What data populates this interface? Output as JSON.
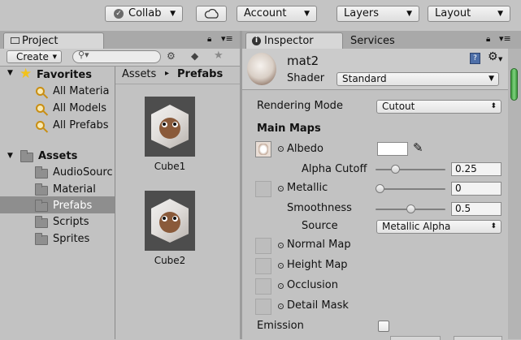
{
  "toolbar": {
    "collab": {
      "label": "Collab",
      "icon": "check-circle-icon"
    },
    "cloud": {
      "icon": "cloud-icon"
    },
    "account": {
      "label": "Account"
    },
    "layers": {
      "label": "Layers"
    },
    "layout": {
      "label": "Layout"
    }
  },
  "project": {
    "tab_label": "Project",
    "create_label": "Create",
    "search_placeholder": "",
    "favorites": {
      "label": "Favorites",
      "items": [
        "All Materia",
        "All Models",
        "All Prefabs"
      ]
    },
    "assets": {
      "label": "Assets",
      "folders": [
        "AudioSourc",
        "Material",
        "Prefabs",
        "Scripts",
        "Sprites"
      ],
      "selected": "Prefabs"
    },
    "breadcrumb": {
      "root": "Assets",
      "separator": "▸",
      "current": "Prefabs"
    },
    "items": [
      "Cube1",
      "Cube2"
    ]
  },
  "inspector": {
    "tab_label": "Inspector",
    "services_tab_label": "Services",
    "material_name": "mat2",
    "shader_label": "Shader",
    "shader_value": "Standard",
    "rendering_mode_label": "Rendering Mode",
    "rendering_mode_value": "Cutout",
    "main_maps_label": "Main Maps",
    "albedo_label": "Albedo",
    "albedo_color": "#ffffff",
    "alpha_cutoff_label": "Alpha Cutoff",
    "alpha_cutoff_value": "0.25",
    "alpha_cutoff_fraction": 0.25,
    "metallic_label": "Metallic",
    "metallic_value": "0",
    "metallic_fraction": 0,
    "smoothness_label": "Smoothness",
    "smoothness_value": "0.5",
    "smoothness_fraction": 0.5,
    "source_label": "Source",
    "source_value": "Metallic Alpha",
    "normal_map_label": "Normal Map",
    "height_map_label": "Height Map",
    "occlusion_label": "Occlusion",
    "detail_mask_label": "Detail Mask",
    "emission_label": "Emission",
    "emission_checked": false
  },
  "colors": {
    "panel_bg": "#c2c2c2",
    "selection": "#8e8e8e",
    "star": "#f2c21b"
  }
}
